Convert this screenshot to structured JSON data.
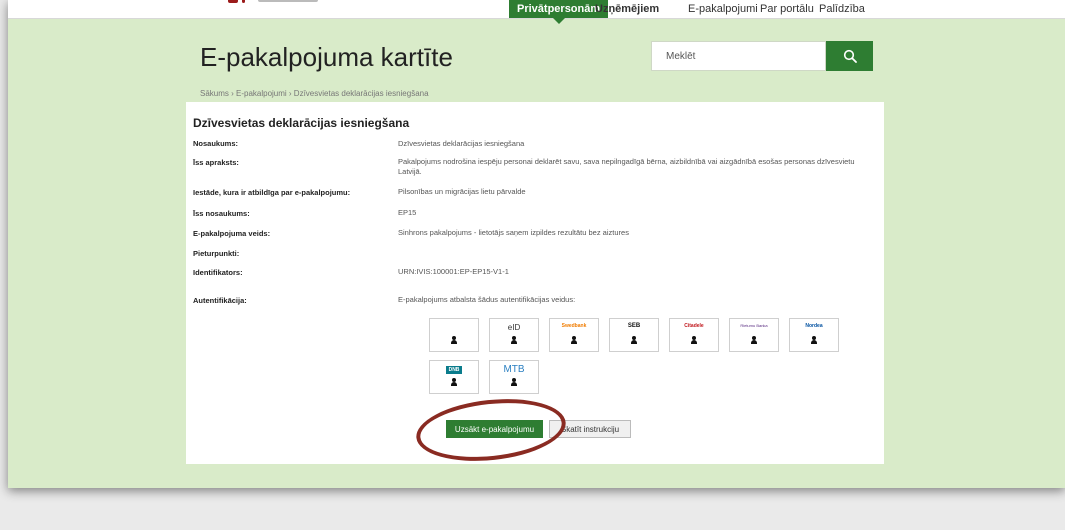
{
  "nav": {
    "active": "Privātpersonām",
    "items": [
      "Uzņēmējiem",
      "E-pakalpojumi",
      "Par portālu",
      "Palīdzība"
    ]
  },
  "page": {
    "title": "E-pakalpojuma kartīte",
    "breadcrumb": "Sākums › E-pakalpojumi › Dzīvesvietas deklarācijas iesniegšana"
  },
  "search": {
    "placeholder": "Meklēt"
  },
  "card": {
    "title": "Dzīvesvietas deklarācijas iesniegšana",
    "rows": [
      {
        "label": "Nosaukums:",
        "value": "Dzīvesvietas deklarācijas iesniegšana"
      },
      {
        "label": "Īss apraksts:",
        "value": "Pakalpojums nodrošina iespēju personai deklarēt savu, sava nepilngadīgā bērna, aizbildnībā vai aizgādnībā esošas personas dzīvesvietu Latvijā."
      },
      {
        "label": "Iestāde, kura ir atbildīga par e-pakalpojumu:",
        "value": "Pilsonības un migrācijas lietu pārvalde"
      },
      {
        "label": "Īss nosaukums:",
        "value": "EP15"
      },
      {
        "label": "E-pakalpojuma veids:",
        "value": "Sinhrons pakalpojums - lietotājs saņem izpildes rezultātu bez aiztures"
      },
      {
        "label": "Pieturpunkti:",
        "value": ""
      },
      {
        "label": "Identifikators:",
        "value": "URN:IVIS:100001:EP-EP15-V1-1"
      },
      {
        "label": "Autentifikācija:",
        "value": "E-pakalpojums atbalsta šādus autentifikācijas veidus:"
      }
    ],
    "auth_methods": [
      "",
      "eID",
      "Swedbank",
      "SEB",
      "Citadele",
      "Rietumu Banka",
      "Nordea",
      "DNB",
      "MTB"
    ]
  },
  "actions": {
    "start": "Uzsākt e-pakalpojumu",
    "instructions": "Skatīt instrukciju"
  },
  "colors": {
    "accent": "#2e7d32",
    "page_bg": "#d9ebc9",
    "annotation": "#8a2b22"
  }
}
